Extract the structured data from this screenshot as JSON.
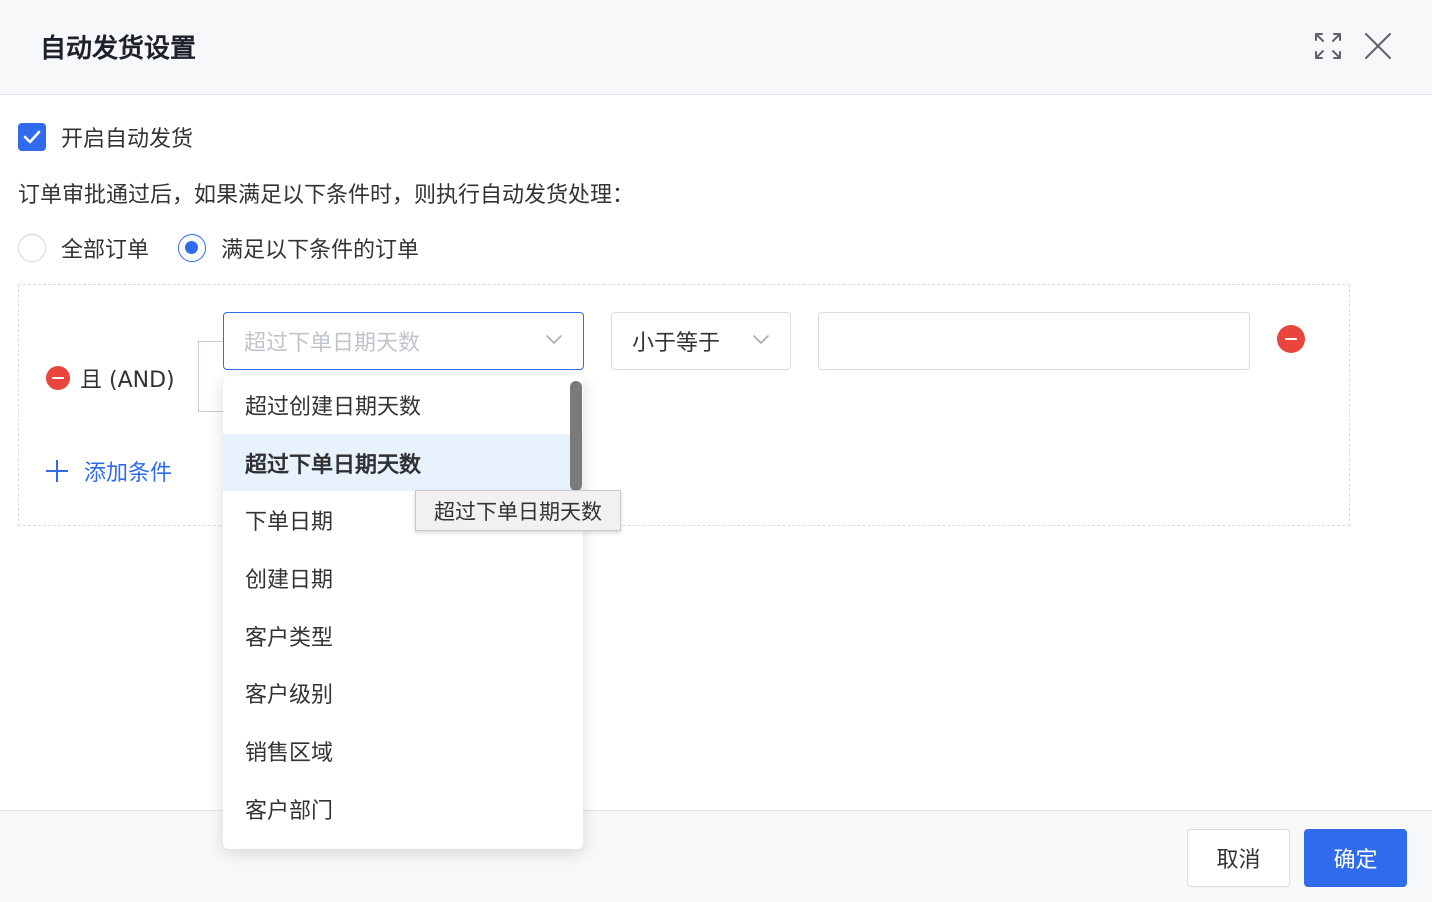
{
  "dialog": {
    "title": "自动发货设置",
    "expand_icon": "expand-icon",
    "close_icon": "close-icon"
  },
  "enable": {
    "checked": true,
    "label": "开启自动发货"
  },
  "description": "订单审批通过后，如果满足以下条件时，则执行自动发货处理：",
  "scope": {
    "options": [
      {
        "label": "全部订单",
        "selected": false
      },
      {
        "label": "满足以下条件的订单",
        "selected": true
      }
    ]
  },
  "conditions": {
    "logic_label": "且 (AND)",
    "field_select_value": "超过下单日期天数",
    "operator_select_value": "小于等于",
    "value_input": "",
    "add_label": "添加条件"
  },
  "dropdown": {
    "items": [
      {
        "label": "超过创建日期天数",
        "active": false
      },
      {
        "label": "超过下单日期天数",
        "active": true
      },
      {
        "label": "下单日期",
        "active": false
      },
      {
        "label": "创建日期",
        "active": false
      },
      {
        "label": "客户类型",
        "active": false
      },
      {
        "label": "客户级别",
        "active": false
      },
      {
        "label": "销售区域",
        "active": false
      },
      {
        "label": "客户部门",
        "active": false
      }
    ]
  },
  "tooltip": "超过下单日期天数",
  "footer": {
    "cancel_label": "取消",
    "confirm_label": "确定"
  },
  "colors": {
    "primary": "#2f6bec",
    "danger": "#e9453c"
  }
}
